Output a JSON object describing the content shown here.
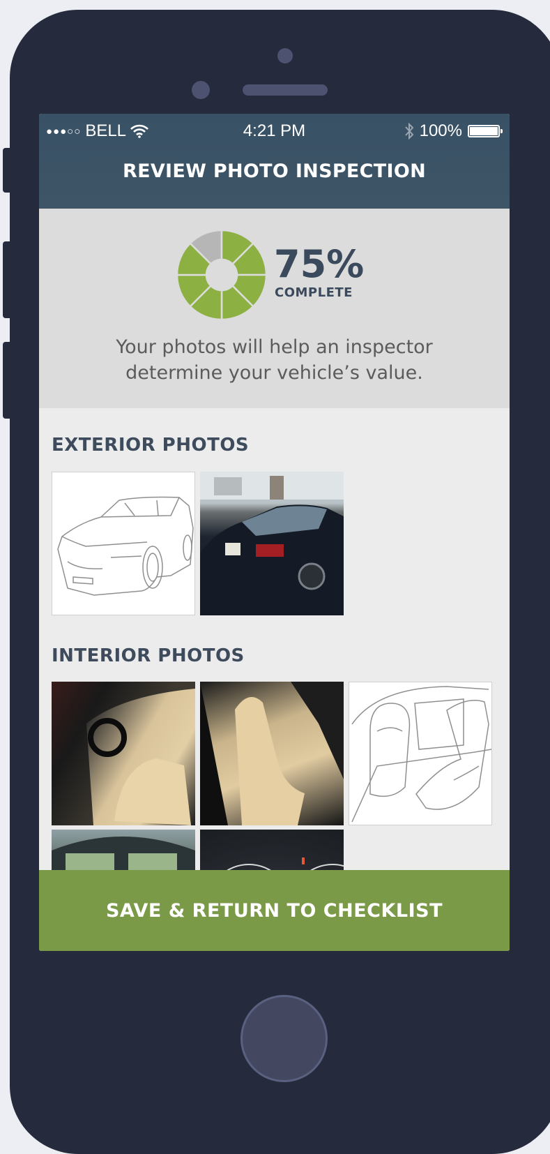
{
  "status_bar": {
    "signal": "●●●○○",
    "carrier": "BELL",
    "time": "4:21 PM",
    "battery": "100%"
  },
  "header": {
    "title": "REVIEW PHOTO INSPECTION"
  },
  "progress": {
    "percent_text": "75%",
    "label": "COMPLETE",
    "fraction": 0.75,
    "description": "Your photos will help an inspector determine your vehicle’s value.",
    "segments_total": 8,
    "segments_done": 7,
    "colors": {
      "done": "#8db043",
      "todo": "#b6b6b6"
    }
  },
  "sections": {
    "exterior_title": "EXTERIOR PHOTOS",
    "interior_title": "INTERIOR PHOTOS"
  },
  "cta": {
    "label": "SAVE & RETURN TO CHECKLIST"
  },
  "colors": {
    "header": "#3e5567",
    "accent_green": "#7b9a48",
    "phone_body": "#252b3d"
  }
}
